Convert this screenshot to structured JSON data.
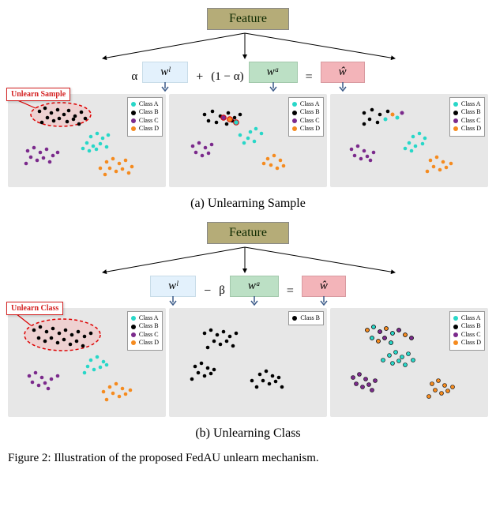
{
  "feature_label": "Feature",
  "section_a": {
    "alpha": "α",
    "wl": "wˡ",
    "plus": "+",
    "one_minus_alpha": "(1 − α)",
    "wa": "wᵃ",
    "eq": "=",
    "wh": "ŵ",
    "unlearn_badge": "Unlearn Sample",
    "caption": "(a) Unlearning Sample",
    "legend": {
      "a": "Class A",
      "b": "Class B",
      "c": "Class C",
      "d": "Class D"
    }
  },
  "section_b": {
    "wl": "wˡ",
    "minus": "−",
    "beta": "β",
    "wa": "wᵃ",
    "eq": "=",
    "wh": "ŵ",
    "unlearn_badge": "Unlearn Class",
    "caption": "(b) Unlearning Class",
    "legend_full": {
      "a": "Class A",
      "b": "Class B",
      "c": "Class C",
      "d": "Class D"
    },
    "legend_single": {
      "b": "Class B"
    }
  },
  "main_caption": "Figure 2: Illustration of the proposed FedAU unlearn mechanism.",
  "chart_data": [
    {
      "id": "a-left",
      "type": "scatter",
      "description": "4 well-separated clusters A/B/C/D with a red dashed ellipse around part of black Class B marking samples to unlearn",
      "clusters": [
        "A",
        "B",
        "C",
        "D"
      ],
      "unlearn_region": "subset of Class B"
    },
    {
      "id": "a-mid",
      "type": "scatter",
      "description": "Same 4 clusters but more overlapped/mixed in the center",
      "clusters": [
        "A",
        "B",
        "C",
        "D"
      ]
    },
    {
      "id": "a-right",
      "type": "scatter",
      "description": "Result after combination; clusters similar to left but with unlearned black samples replaced/mixed with other-colored dots",
      "clusters": [
        "A",
        "B",
        "C",
        "D"
      ]
    },
    {
      "id": "b-left",
      "type": "scatter",
      "description": "4 clusters A/B/C/D with red dashed ellipse around all of Class B",
      "clusters": [
        "A",
        "B",
        "C",
        "D"
      ],
      "unlearn_region": "all of Class B"
    },
    {
      "id": "b-mid",
      "type": "scatter",
      "description": "Only Class B points, spread into three black sub-clusters",
      "clusters": [
        "B"
      ]
    },
    {
      "id": "b-right",
      "type": "scatter",
      "description": "Result: black Class B removed and its region filled with outlined dots of other classes",
      "clusters": [
        "A",
        "C",
        "D"
      ]
    }
  ]
}
